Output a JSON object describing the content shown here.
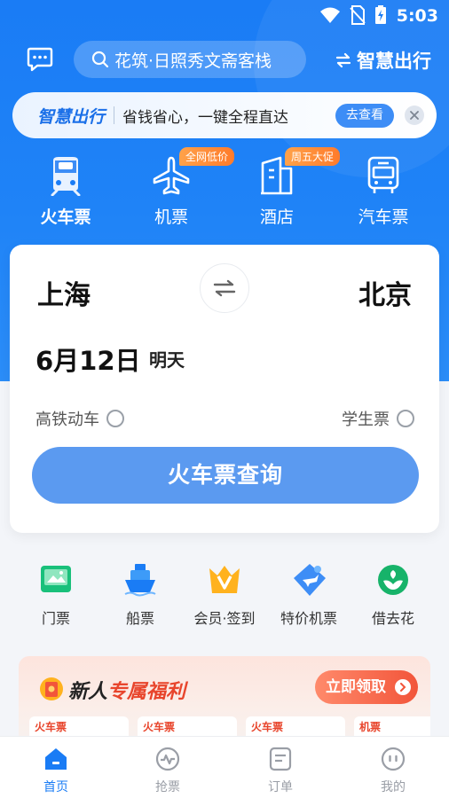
{
  "status_bar": {
    "time": "5:03"
  },
  "header": {
    "search_placeholder": "花筑·日照秀文斋客栈",
    "smart_travel_label": "智慧出行"
  },
  "promo": {
    "logo": "智慧出行",
    "slogan": "省钱省心，一键全程直达",
    "button": "去查看"
  },
  "categories": [
    {
      "label": "火车票",
      "icon": "train-icon",
      "badge": ""
    },
    {
      "label": "机票",
      "icon": "plane-icon",
      "badge": "全网低价"
    },
    {
      "label": "酒店",
      "icon": "hotel-icon",
      "badge": "周五大促"
    },
    {
      "label": "汽车票",
      "icon": "bus-icon",
      "badge": ""
    }
  ],
  "booking": {
    "from": "上海",
    "to": "北京",
    "date": "6月12日",
    "day": "明天",
    "option_high_speed": "高铁动车",
    "option_student": "学生票",
    "search_button": "火车票查询"
  },
  "services": [
    {
      "label": "门票",
      "icon": "ticket-icon"
    },
    {
      "label": "船票",
      "icon": "ship-icon"
    },
    {
      "label": "会员·签到",
      "icon": "vip-crown-icon"
    },
    {
      "label": "特价机票",
      "icon": "discount-flight-icon"
    },
    {
      "label": "借去花",
      "icon": "finance-icon"
    }
  ],
  "welfare": {
    "title_plain": "新人",
    "title_highlight": "专属福利",
    "claim_button": "立即领取",
    "coupons": [
      "火车票",
      "火车票",
      "火车票",
      "机票"
    ]
  },
  "tabbar": [
    {
      "label": "首页",
      "icon": "home-icon",
      "active": true
    },
    {
      "label": "抢票",
      "icon": "grab-ticket-icon",
      "active": false
    },
    {
      "label": "订单",
      "icon": "order-icon",
      "active": false
    },
    {
      "label": "我的",
      "icon": "profile-icon",
      "active": false
    }
  ],
  "colors": {
    "primary": "#1a7cf5",
    "button": "#5b9af0",
    "accent_red": "#e8452c",
    "badge_orange": "#ff8a3d"
  }
}
